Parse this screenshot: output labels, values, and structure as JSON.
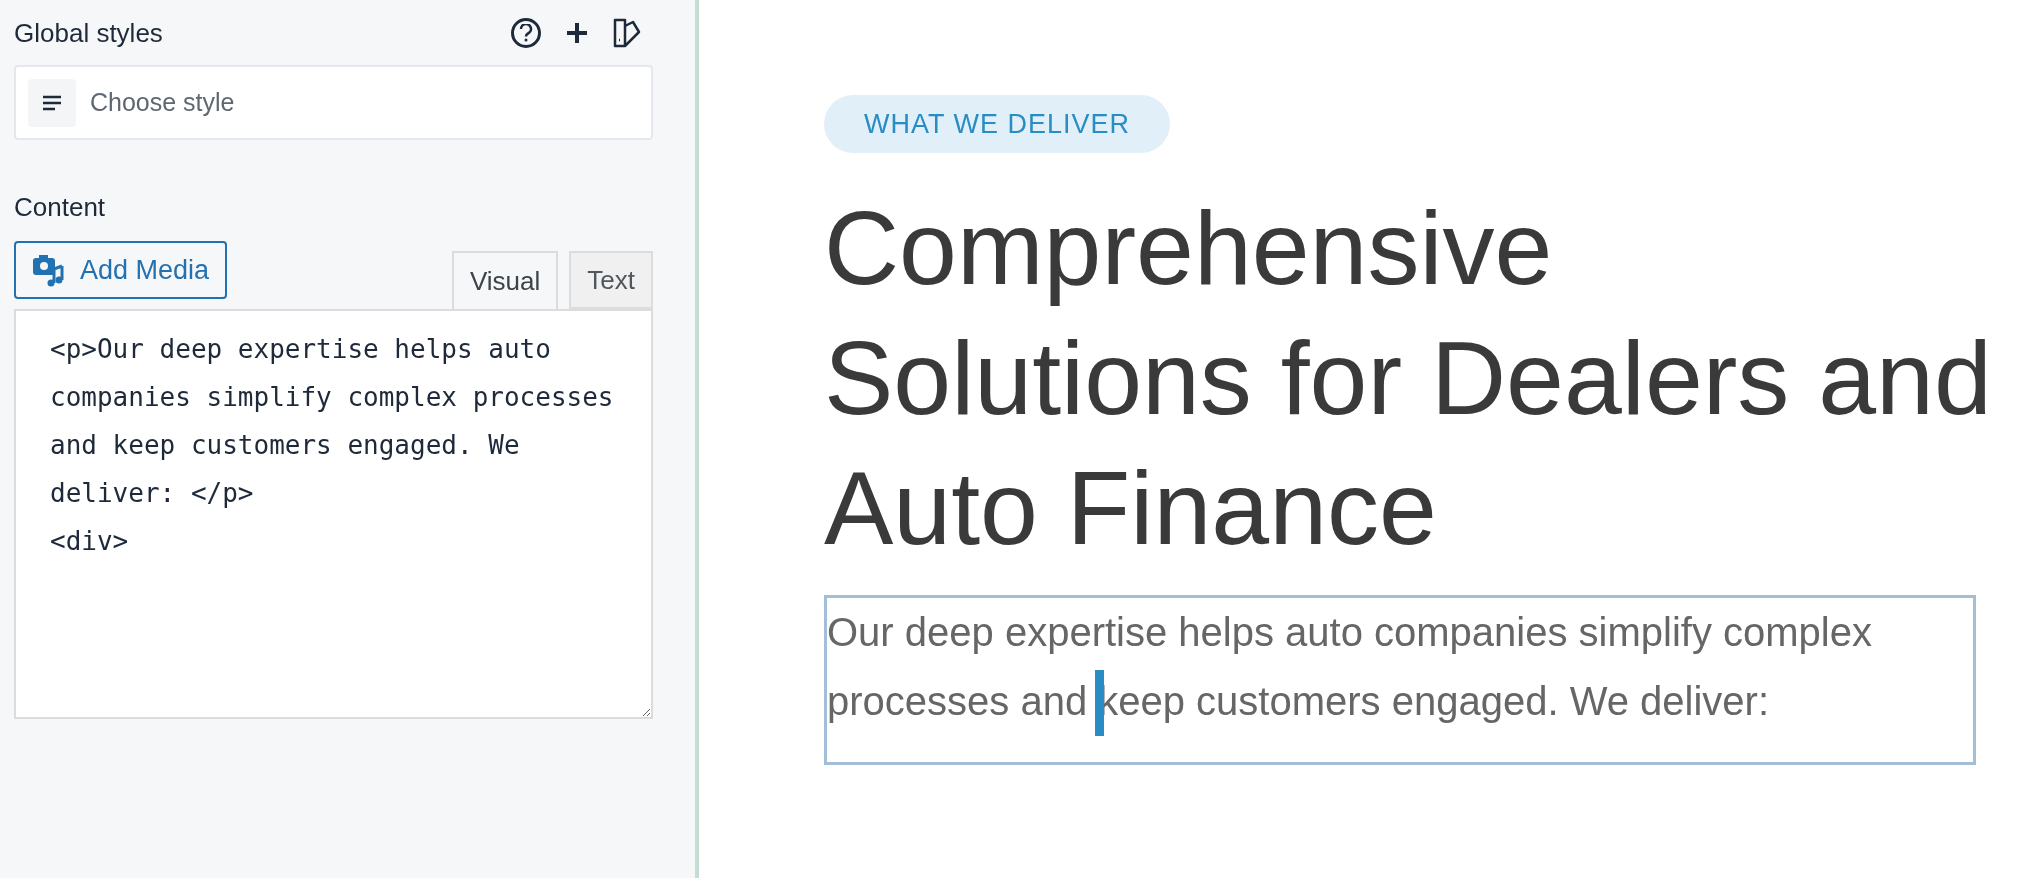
{
  "sidebar": {
    "global_styles": {
      "title": "Global styles",
      "style_select": {
        "placeholder": "Choose style"
      }
    },
    "content": {
      "label": "Content",
      "add_media": "Add Media",
      "tabs": [
        {
          "label": "Visual",
          "selected": true
        },
        {
          "label": "Text",
          "selected": false
        }
      ],
      "editor_value": "<p>Our deep expertise helps auto companies simplify complex processes and keep customers engaged. We deliver: </p>\n<div>"
    }
  },
  "preview": {
    "badge": "WHAT WE DELIVER",
    "heading_lines": [
      "Comprehensive",
      "Solutions for Dealers and",
      "Auto Finance"
    ],
    "paragraph": "Our deep expertise helps auto companies simplify complex processes and keep customers engaged. We deliver:",
    "paragraph_selected": true,
    "cursor_visible": true
  }
}
